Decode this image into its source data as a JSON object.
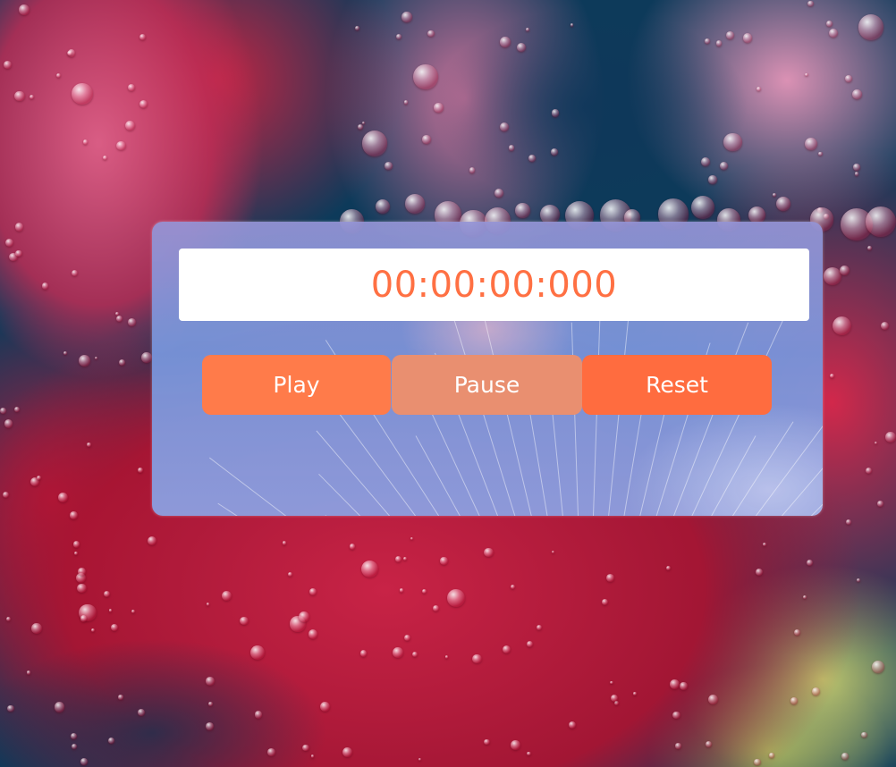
{
  "stopwatch": {
    "display": "00:00:00:000",
    "buttons": {
      "play": "Play",
      "pause": "Pause",
      "reset": "Reset"
    }
  },
  "colors": {
    "display_text": "#ff7043",
    "display_background": "#ffffff",
    "play_button": "#ff7b4a",
    "pause_button": "#e98f70",
    "reset_button": "#ff6c3f",
    "button_text": "#ffffff"
  }
}
